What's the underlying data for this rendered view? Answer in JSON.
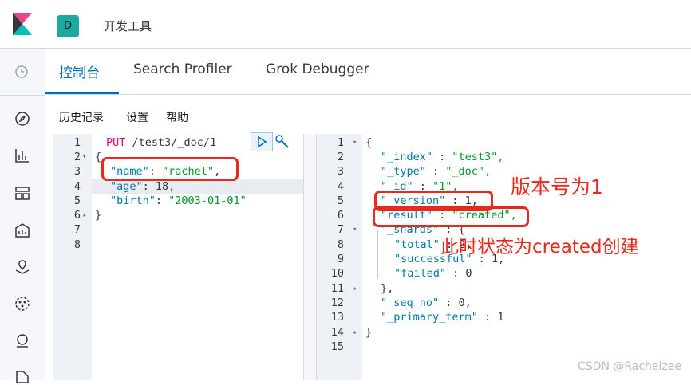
{
  "header": {
    "space_initial": "D",
    "app_title": "开发工具"
  },
  "tabs": [
    {
      "label": "控制台",
      "active": true
    },
    {
      "label": "Search Profiler",
      "active": false
    },
    {
      "label": "Grok Debugger",
      "active": false
    }
  ],
  "menu": {
    "history": "历史记录",
    "settings": "设置",
    "help": "帮助"
  },
  "request": {
    "lines": [
      {
        "n": "1",
        "fold": ""
      },
      {
        "n": "2",
        "fold": "▾"
      },
      {
        "n": "3",
        "fold": ""
      },
      {
        "n": "4",
        "fold": ""
      },
      {
        "n": "5",
        "fold": ""
      },
      {
        "n": "6",
        "fold": "▴"
      },
      {
        "n": "7",
        "fold": ""
      },
      {
        "n": "8",
        "fold": ""
      }
    ],
    "method": "PUT",
    "path": "/test3/_doc/1",
    "open_brace": "{",
    "close_brace": "}",
    "fields": [
      {
        "key": "\"name\"",
        "value": "\"rachel\"",
        "trail": ","
      },
      {
        "key": "\"age\"",
        "value": "18",
        "trail": ","
      },
      {
        "key": "\"birth\"",
        "value": "\"2003-01-01\"",
        "trail": ""
      }
    ]
  },
  "response": {
    "line_numbers": [
      "1",
      "2",
      "3",
      "4",
      "5",
      "6",
      "7",
      "8",
      "9",
      "10",
      "11",
      "12",
      "13",
      "14",
      "15"
    ],
    "folds": {
      "1": "▾",
      "7": "▾",
      "11": "▴",
      "14": "▴"
    },
    "lines": [
      {
        "k": "",
        "v": "{"
      },
      {
        "k": "\"_index\"",
        "v": "\"test3\","
      },
      {
        "k": "\"_type\"",
        "v": "\"_doc\","
      },
      {
        "k": "\"_id\"",
        "v": "\"1\","
      },
      {
        "k": "\"_version\"",
        "v": "1,"
      },
      {
        "k": "\"result\"",
        "v": "\"created\","
      },
      {
        "k": "\"_shards\"",
        "v": "{"
      },
      {
        "k": "\"total\"",
        "v": "2,"
      },
      {
        "k": "\"successful\"",
        "v": "1,"
      },
      {
        "k": "\"failed\"",
        "v": "0"
      },
      {
        "k": "",
        "v": "},"
      },
      {
        "k": "\"_seq_no\"",
        "v": "0,"
      },
      {
        "k": "\"_primary_term\"",
        "v": "1"
      },
      {
        "k": "",
        "v": "}"
      },
      {
        "k": "",
        "v": ""
      }
    ]
  },
  "annotations": {
    "version_note": "版本号为1",
    "created_note": "此时状态为created创建"
  },
  "watermark": "CSDN @Rachelzee",
  "colors": {
    "accent": "#006bb8",
    "annotation": "#e8291c",
    "space_badge": "#1ba9a2"
  }
}
